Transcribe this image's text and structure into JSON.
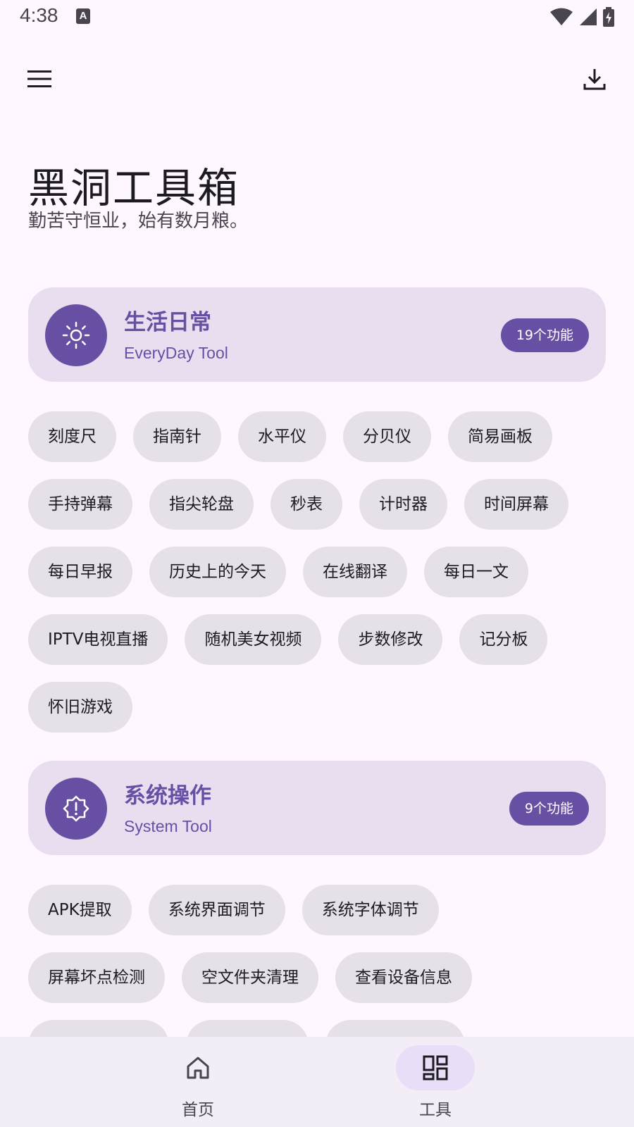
{
  "status_bar": {
    "time": "4:38",
    "icons": [
      "a-notification-icon",
      "wifi-icon",
      "signal-icon",
      "battery-icon"
    ]
  },
  "app_bar": {
    "menu_icon": "menu-icon",
    "download_icon": "download-icon"
  },
  "header": {
    "title": "黑洞工具箱",
    "subtitle": "勤苦守恒业，始有数月粮。"
  },
  "colors": {
    "background": "#FEF7FF",
    "accent": "#6750A4",
    "card": "#E8DEF0",
    "chip": "#E6E0E9",
    "nav": "#F3EDF7"
  },
  "sections": [
    {
      "title": "生活日常",
      "subtitle": "EveryDay Tool",
      "badge": "19个功能",
      "icon": "sun-icon",
      "chips": [
        "刻度尺",
        "指南针",
        "水平仪",
        "分贝仪",
        "简易画板",
        "手持弹幕",
        "指尖轮盘",
        "秒表",
        "计时器",
        "时间屏幕",
        "每日早报",
        "历史上的今天",
        "在线翻译",
        "每日一文",
        "IPTV电视直播",
        "随机美女视频",
        "步数修改",
        "记分板",
        "怀旧游戏"
      ]
    },
    {
      "title": "系统操作",
      "subtitle": "System Tool",
      "badge": "9个功能",
      "icon": "system-alert-icon",
      "chips": [
        "APK提取",
        "系统界面调节",
        "系统字体调节",
        "屏幕坏点检测",
        "空文件夹清理",
        "查看设备信息"
      ]
    }
  ],
  "bottom_nav": {
    "items": [
      {
        "label": "首页",
        "icon": "home-icon",
        "selected": false
      },
      {
        "label": "工具",
        "icon": "grid-icon",
        "selected": true
      }
    ]
  }
}
